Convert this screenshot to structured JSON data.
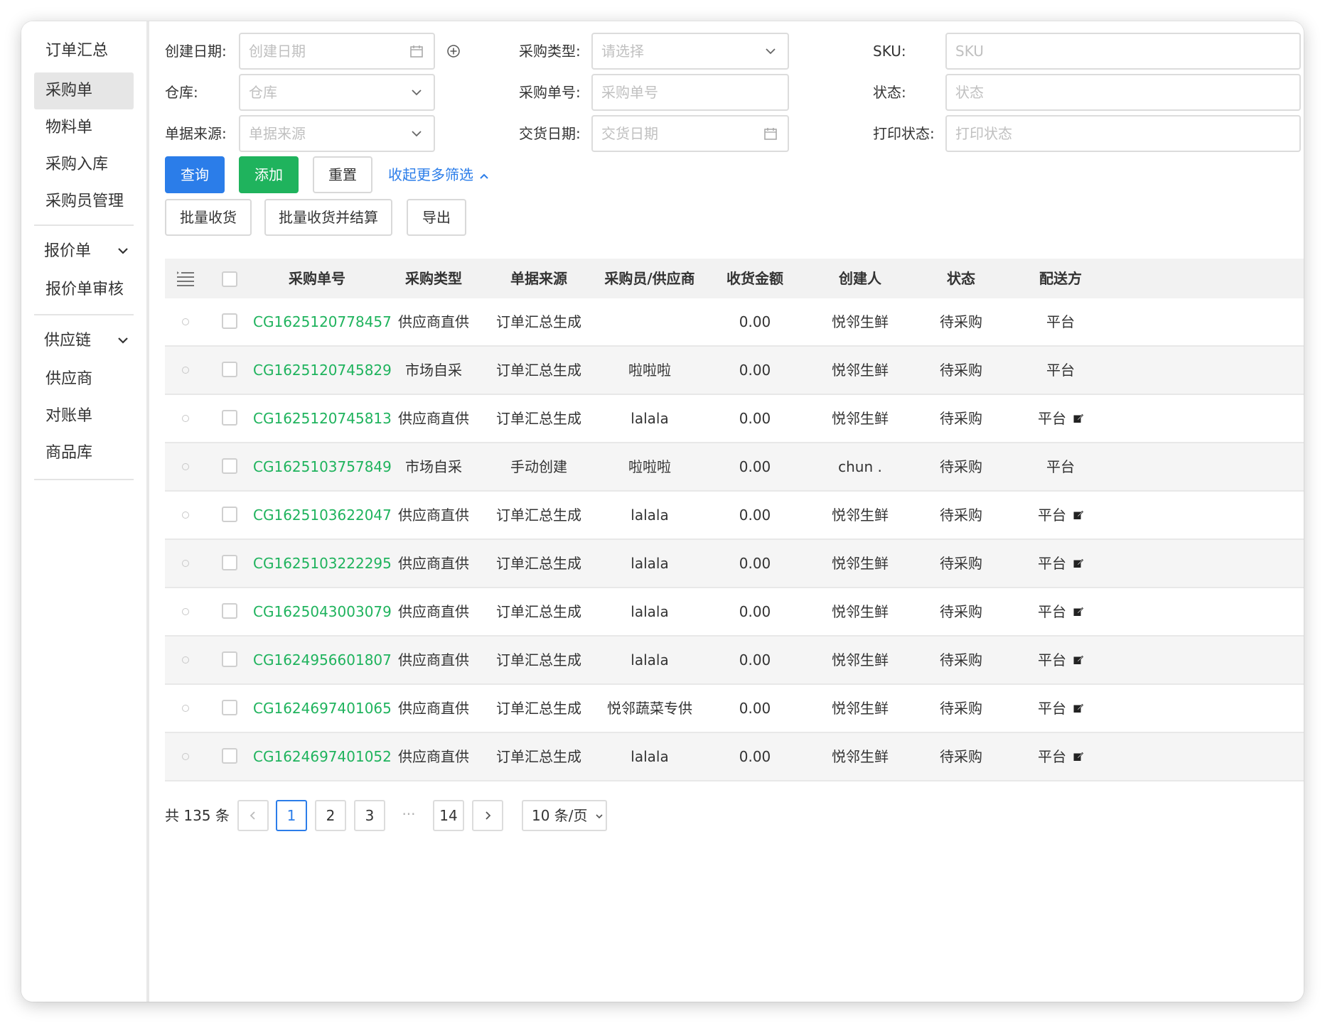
{
  "sidebar": {
    "items": [
      {
        "label": "订单汇总"
      },
      {
        "label": "采购单"
      },
      {
        "label": "物料单"
      },
      {
        "label": "采购入库"
      },
      {
        "label": "采购员管理"
      }
    ],
    "groups": [
      {
        "label": "报价单",
        "children": [
          {
            "label": "报价单审核"
          }
        ]
      },
      {
        "label": "供应链",
        "children": [
          {
            "label": "供应商"
          },
          {
            "label": "对账单"
          },
          {
            "label": "商品库"
          }
        ]
      }
    ]
  },
  "filters": {
    "create_date": {
      "label": "创建日期:",
      "placeholder": "创建日期"
    },
    "purchase_type": {
      "label": "采购类型:",
      "placeholder": "请选择"
    },
    "sku": {
      "label": "SKU:",
      "placeholder": "SKU"
    },
    "warehouse": {
      "label": "仓库:",
      "placeholder": "仓库"
    },
    "purchase_no": {
      "label": "采购单号:",
      "placeholder": "采购单号"
    },
    "status": {
      "label": "状态:",
      "placeholder": "状态"
    },
    "source": {
      "label": "单据来源:",
      "placeholder": "单据来源"
    },
    "delivery_date": {
      "label": "交货日期:",
      "placeholder": "交货日期"
    },
    "print_status": {
      "label": "打印状态:",
      "placeholder": "打印状态"
    }
  },
  "actions": {
    "query": "查询",
    "add": "添加",
    "reset": "重置",
    "collapse": "收起更多筛选",
    "batch_receive": "批量收货",
    "batch_receive_settle": "批量收货并结算",
    "export": "导出"
  },
  "table": {
    "columns": [
      "采购单号",
      "采购类型",
      "单据来源",
      "采购员/供应商",
      "收货金额",
      "创建人",
      "状态",
      "配送方"
    ],
    "rows": [
      {
        "code": "CG1625120778457",
        "type": "供应商直供",
        "source": "订单汇总生成",
        "buyer": "",
        "amount": "0.00",
        "creator": "悦邻生鲜",
        "status": "待采购",
        "delivery": "平台",
        "edit": false
      },
      {
        "code": "CG1625120745829",
        "type": "市场自采",
        "source": "订单汇总生成",
        "buyer": "啦啦啦",
        "amount": "0.00",
        "creator": "悦邻生鲜",
        "status": "待采购",
        "delivery": "平台",
        "edit": false
      },
      {
        "code": "CG1625120745813",
        "type": "供应商直供",
        "source": "订单汇总生成",
        "buyer": "lalala",
        "amount": "0.00",
        "creator": "悦邻生鲜",
        "status": "待采购",
        "delivery": "平台",
        "edit": true
      },
      {
        "code": "CG1625103757849",
        "type": "市场自采",
        "source": "手动创建",
        "buyer": "啦啦啦",
        "amount": "0.00",
        "creator": "chun .",
        "status": "待采购",
        "delivery": "平台",
        "edit": false
      },
      {
        "code": "CG1625103622047",
        "type": "供应商直供",
        "source": "订单汇总生成",
        "buyer": "lalala",
        "amount": "0.00",
        "creator": "悦邻生鲜",
        "status": "待采购",
        "delivery": "平台",
        "edit": true
      },
      {
        "code": "CG1625103222295",
        "type": "供应商直供",
        "source": "订单汇总生成",
        "buyer": "lalala",
        "amount": "0.00",
        "creator": "悦邻生鲜",
        "status": "待采购",
        "delivery": "平台",
        "edit": true
      },
      {
        "code": "CG1625043003079",
        "type": "供应商直供",
        "source": "订单汇总生成",
        "buyer": "lalala",
        "amount": "0.00",
        "creator": "悦邻生鲜",
        "status": "待采购",
        "delivery": "平台",
        "edit": true
      },
      {
        "code": "CG1624956601807",
        "type": "供应商直供",
        "source": "订单汇总生成",
        "buyer": "lalala",
        "amount": "0.00",
        "creator": "悦邻生鲜",
        "status": "待采购",
        "delivery": "平台",
        "edit": true
      },
      {
        "code": "CG1624697401065",
        "type": "供应商直供",
        "source": "订单汇总生成",
        "buyer": "悦邻蔬菜专供",
        "amount": "0.00",
        "creator": "悦邻生鲜",
        "status": "待采购",
        "delivery": "平台",
        "edit": true
      },
      {
        "code": "CG1624697401052",
        "type": "供应商直供",
        "source": "订单汇总生成",
        "buyer": "lalala",
        "amount": "0.00",
        "creator": "悦邻生鲜",
        "status": "待采购",
        "delivery": "平台",
        "edit": true
      }
    ]
  },
  "pagination": {
    "total": "共 135 条",
    "pages": [
      "1",
      "2",
      "3",
      "14"
    ],
    "current": "1",
    "ellipsis": "···",
    "page_size": "10 条/页"
  },
  "colors": {
    "primary": "#2b7de9",
    "success": "#1fb35d",
    "code_link": "#1fb35d"
  },
  "icons": {
    "date": "calendar-icon",
    "dropdown": "chevron-down-icon",
    "add_circle": "plus-circle-icon",
    "collapse": "chevron-up-icon",
    "column_settings": "list-settings-icon",
    "edit": "edit-icon"
  }
}
